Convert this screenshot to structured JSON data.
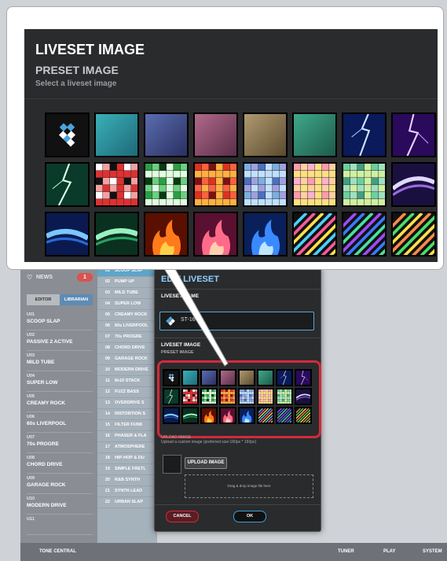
{
  "callout": {
    "title": "LIVESET IMAGE",
    "subtitle": "PRESET IMAGE",
    "hint": "Select a liveset image"
  },
  "sidebar": {
    "news_label": "NEWS",
    "news_count": "1",
    "tabs": [
      "EDITOR",
      "LIBRARIAN"
    ],
    "items": [
      {
        "num": "U01",
        "name": "SCOOP SLAP"
      },
      {
        "num": "U02",
        "name": "PASSIVE 2 ACTIVE"
      },
      {
        "num": "U03",
        "name": "MILD TUBE"
      },
      {
        "num": "U04",
        "name": "SUPER LOW"
      },
      {
        "num": "U05",
        "name": "CREAMY ROCK"
      },
      {
        "num": "U06",
        "name": "60s LIVERPOOL"
      },
      {
        "num": "U07",
        "name": "70s PROGRE"
      },
      {
        "num": "U08",
        "name": "CHORD DRIVE"
      },
      {
        "num": "U09",
        "name": "GARAGE ROCK"
      },
      {
        "num": "U10",
        "name": "MODERN DRIVE"
      },
      {
        "num": "U11",
        "name": ""
      }
    ]
  },
  "list": [
    {
      "num": "01",
      "name": "SCOOP SLAP",
      "selected": true
    },
    {
      "num": "02",
      "name": "PUMP UP"
    },
    {
      "num": "03",
      "name": "MILD TUBE"
    },
    {
      "num": "04",
      "name": "SUPER LOW"
    },
    {
      "num": "05",
      "name": "CREAMY ROCK"
    },
    {
      "num": "06",
      "name": "60s LIVERPOOL"
    },
    {
      "num": "07",
      "name": "70s PROGRE"
    },
    {
      "num": "08",
      "name": "CHORD DRIVE"
    },
    {
      "num": "09",
      "name": "GARAGE ROCK"
    },
    {
      "num": "10",
      "name": "MODERN DRIVE"
    },
    {
      "num": "11",
      "name": "8x10 STACK"
    },
    {
      "num": "12",
      "name": "FUZZ BASS"
    },
    {
      "num": "13",
      "name": "OVERDRIVE S"
    },
    {
      "num": "14",
      "name": "DISTORTION S"
    },
    {
      "num": "15",
      "name": "FILTER FUNK"
    },
    {
      "num": "16",
      "name": "PHASER & FLA"
    },
    {
      "num": "17",
      "name": "ATMOSPHERE"
    },
    {
      "num": "18",
      "name": "HIP-HOP & DU"
    },
    {
      "num": "19",
      "name": "SIMPLE FRETL"
    },
    {
      "num": "20",
      "name": "R&B SYNTH"
    },
    {
      "num": "21",
      "name": "SYNTH LEAD"
    },
    {
      "num": "22",
      "name": "URBAN SLAP"
    }
  ],
  "dialog": {
    "title": "EDIT LIVESET",
    "name_label": "LIVESET NAME",
    "name_value": "ST-16",
    "image_label": "LIVESET IMAGE",
    "image_sub": "PRESET IMAGE",
    "upload_label": "UPLOAD IMAGE",
    "upload_hint": "Upload a custom image (preferred size:160px * 160px)",
    "upload_button": "UPLOAD IMAGE",
    "drop_hint": "Drag & drop image file here",
    "cancel": "CANCEL",
    "ok": "OK"
  },
  "bottom": {
    "tone_central": "TONE CENTRAL",
    "tuner": "TUNER",
    "play": "PLAY",
    "system": "SYSTEM"
  },
  "images": [
    "boss-logo",
    "teal",
    "indigo",
    "mauve",
    "khaki",
    "green-teal",
    "lightning-blue",
    "lightning-purple",
    "lightning-green",
    "mosaic-red-white",
    "mosaic-green",
    "mosaic-red",
    "mosaic-blue-pastel",
    "mosaic-pink-yellow",
    "mosaic-green-pastel",
    "wave-purple-white",
    "wave-blue",
    "wave-green",
    "flame-orange",
    "flame-pink",
    "flame-blue",
    "stripes-pink-yellow",
    "stripes-blue-green",
    "stripes-green-yellow"
  ]
}
